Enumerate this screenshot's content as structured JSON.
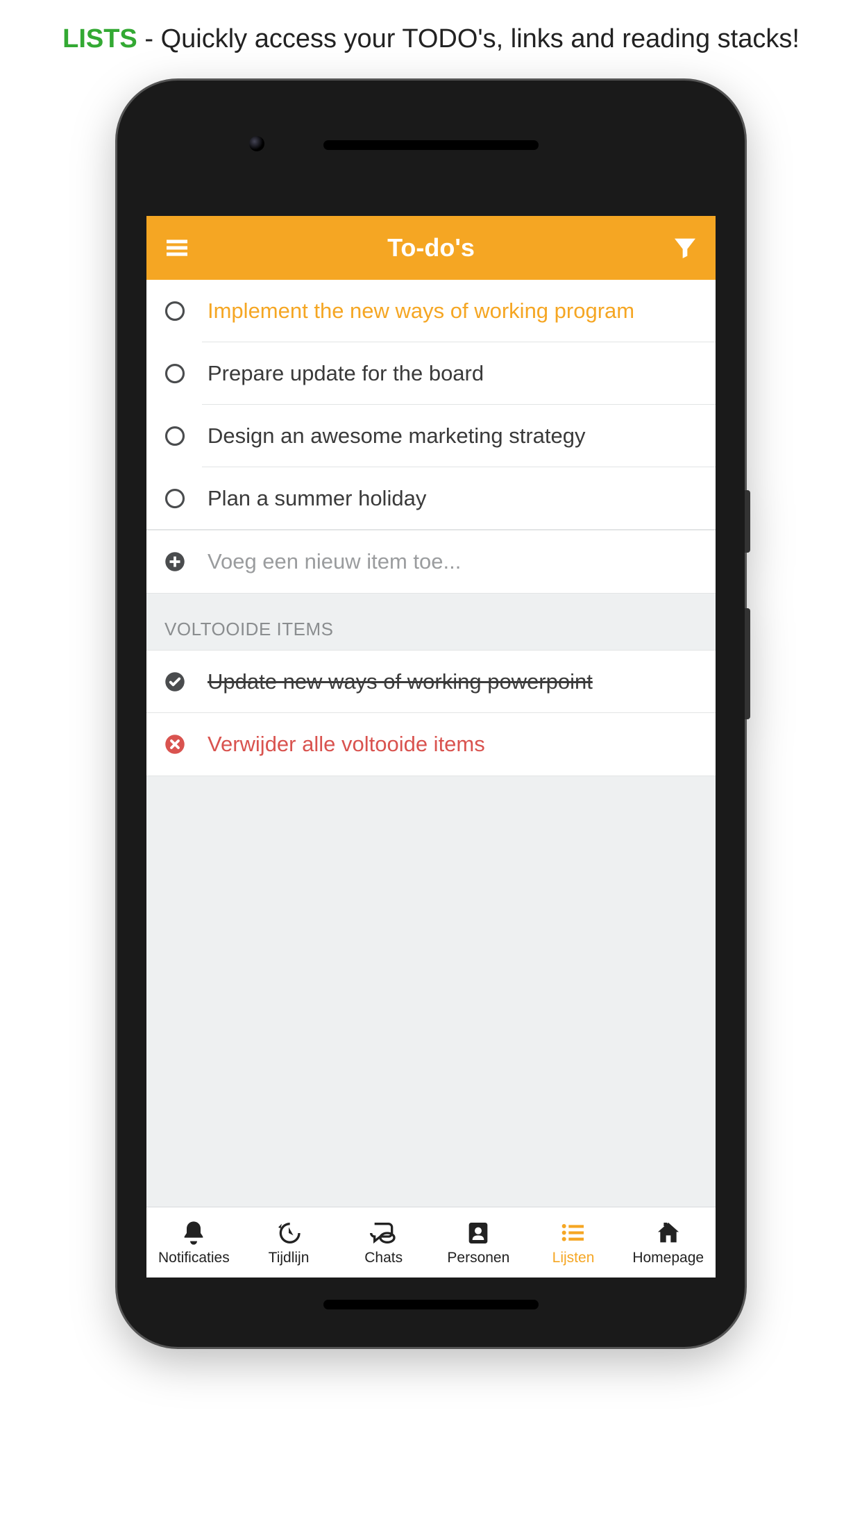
{
  "promo": {
    "highlight": "LISTS",
    "rest": " - Quickly access your TODO's, links and reading stacks!"
  },
  "header": {
    "title": "To-do's"
  },
  "todos": [
    {
      "label": "Implement the new ways of working program",
      "active": true
    },
    {
      "label": "Prepare update for the board",
      "active": false
    },
    {
      "label": "Design an awesome marketing strategy",
      "active": false
    },
    {
      "label": "Plan a summer holiday",
      "active": false
    }
  ],
  "add_item_placeholder": "Voeg een nieuw item toe...",
  "completed_header": "VOLTOOIDE ITEMS",
  "completed": [
    {
      "label": "Update new ways of working powerpoint"
    }
  ],
  "delete_all_label": "Verwijder alle voltooide items",
  "tabs": [
    {
      "id": "notifications",
      "label": "Notificaties"
    },
    {
      "id": "timeline",
      "label": "Tijdlijn"
    },
    {
      "id": "chats",
      "label": "Chats"
    },
    {
      "id": "people",
      "label": "Personen"
    },
    {
      "id": "lists",
      "label": "Lijsten",
      "active": true
    },
    {
      "id": "homepage",
      "label": "Homepage"
    }
  ],
  "colors": {
    "accent": "#f5a623",
    "danger": "#d9534f",
    "highlight_green": "#33a933"
  }
}
